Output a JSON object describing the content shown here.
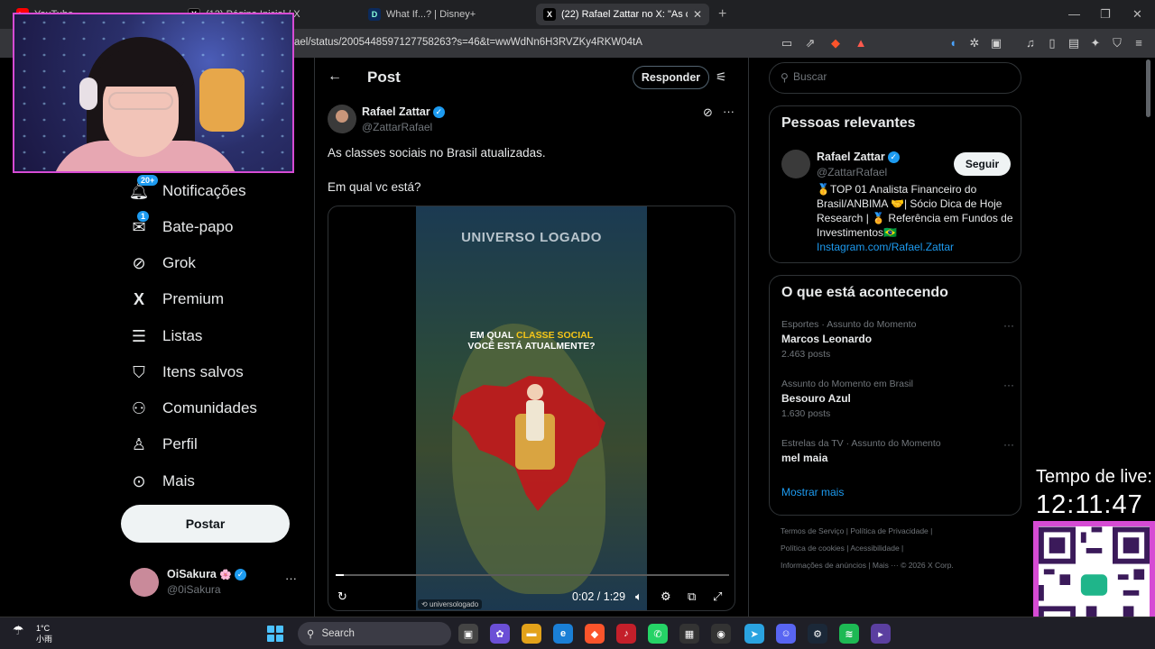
{
  "browser": {
    "tabs": [
      {
        "label": "YouTube",
        "active": false
      },
      {
        "label": "(13) Página Inicial / X",
        "active": false
      },
      {
        "label": "What If...? | Disney+",
        "active": false
      },
      {
        "label": "(22) Rafael Zattar no X: \"As classe",
        "active": true
      }
    ],
    "url": "ael/status/2005448597127758263?s=46&t=wwWdNn6H3RVZKy4RKW04tA"
  },
  "nav": {
    "items": [
      {
        "label": "Notificações",
        "icon": "bell-icon",
        "badge": "20+"
      },
      {
        "label": "Bate-papo",
        "icon": "mail-icon",
        "badge": "1"
      },
      {
        "label": "Grok",
        "icon": "grok-icon",
        "badge": ""
      },
      {
        "label": "Premium",
        "icon": "x-logo-icon",
        "badge": ""
      },
      {
        "label": "Listas",
        "icon": "list-icon",
        "badge": ""
      },
      {
        "label": "Itens salvos",
        "icon": "bookmark-icon",
        "badge": ""
      },
      {
        "label": "Comunidades",
        "icon": "people-icon",
        "badge": ""
      },
      {
        "label": "Perfil",
        "icon": "person-icon",
        "badge": ""
      },
      {
        "label": "Mais",
        "icon": "more-circle-icon",
        "badge": ""
      }
    ],
    "post_button": "Postar",
    "account": {
      "name": "OiSakura",
      "emoji": "🌸",
      "handle": "@0iSakura"
    }
  },
  "post": {
    "header_title": "Post",
    "reply_button": "Responder",
    "author_name": "Rafael Zattar",
    "author_handle": "@ZattarRafael",
    "text_line1": "As classes sociais no Brasil atualizadas.",
    "text_line2": "Em qual vc está?",
    "video": {
      "brand": "UNIVERSO LOGADO",
      "question_a": "EM QUAL ",
      "question_highlight": "CLASSE SOCIAL",
      "question_b": "VOCÊ ESTÁ ATUALMENTE?",
      "watermark": "universologado",
      "time": "0:02 / 1:29",
      "progress": 0.02
    }
  },
  "search": {
    "placeholder": "Buscar"
  },
  "relevant": {
    "title": "Pessoas relevantes",
    "name": "Rafael Zattar",
    "handle": "@ZattarRafael",
    "follow": "Seguir",
    "bio": "🥇TOP 01 Analista Financeiro do Brasil/ANBIMA 🤝| Sócio Dica de Hoje Research | 🏅 Referência em Fundos de Investimentos🇧🇷",
    "link": "Instagram.com/Rafael.Zattar"
  },
  "trends": {
    "title": "O que está acontecendo",
    "items": [
      {
        "meta": "Esportes · Assunto do Momento",
        "name": "Marcos Leonardo",
        "count": "2.463 posts"
      },
      {
        "meta": "Assunto do Momento em Brasil",
        "name": "Besouro Azul",
        "count": "1.630 posts"
      },
      {
        "meta": "Estrelas da TV · Assunto do Momento",
        "name": "mel maia",
        "count": ""
      }
    ],
    "show_more": "Mostrar mais"
  },
  "footer": {
    "row1": "Termos de Serviço  |  Política de Privacidade  |",
    "row2": "Política de cookies  |  Acessibilidade  |",
    "row3": "Informações de anúncios  |  Mais ···  © 2026 X Corp."
  },
  "overlay": {
    "live_label": "Tempo de live:",
    "live_time": "12:11:47"
  },
  "taskbar": {
    "weather_temp": "1°C",
    "weather_desc": "小雨",
    "search": "Search"
  },
  "colors": {
    "accent": "#1d9bf0",
    "stream_border": "#d64bd4",
    "brazil": "#c0181c"
  }
}
